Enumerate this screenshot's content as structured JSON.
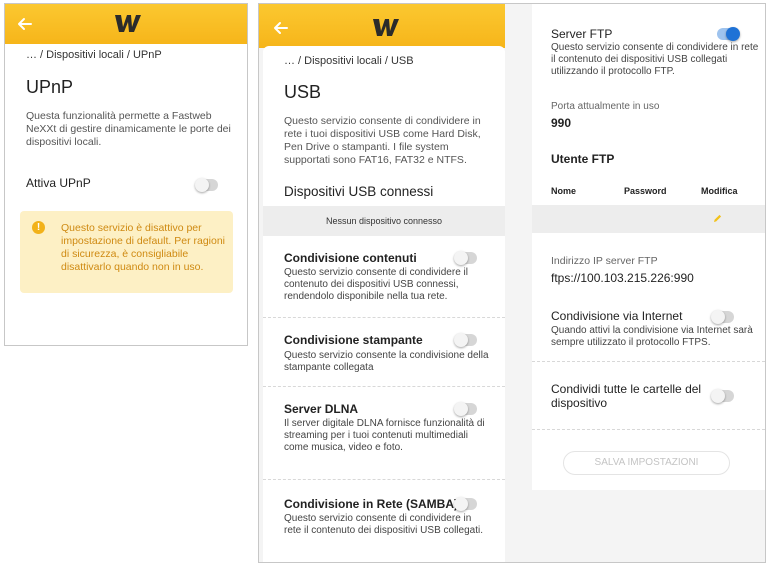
{
  "panel1": {
    "breadcrumb": "… / Dispositivi locali / UPnP",
    "title": "UPnP",
    "description": "Questa funzionalità permette a Fastweb NeXXt di gestire dinamicamente le porte dei dispositivi locali.",
    "toggle_label": "Attiva UPnP",
    "toggle_on": false,
    "warning": "Questo servizio è disattivo per impostazione di default. Per ragioni di sicurezza, è consigliabile disattivarlo quando non in uso."
  },
  "panel2": {
    "breadcrumb": "… / Dispositivi locali / USB",
    "title": "USB",
    "description": "Questo servizio consente di condividere in rete i tuoi dispositivi USB come Hard Disk, Pen Drive o stampanti. I file system supportati sono FAT16, FAT32 e NTFS.",
    "connected_heading": "Dispositivi USB connessi",
    "no_device": "Nessun dispositivo connesso",
    "sections": [
      {
        "title": "Condivisione contenuti",
        "desc": "Questo servizio consente di condividere il contenuto dei dispositivi USB connessi, rendendolo disponibile nella tua rete.",
        "on": false
      },
      {
        "title": "Condivisione stampante",
        "desc": "Questo servizio consente la condivisione della stampante collegata",
        "on": false
      },
      {
        "title": "Server DLNA",
        "desc": "Il server digitale DLNA fornisce funzionalità di streaming per i tuoi contenuti multimediali come musica, video e foto.",
        "on": false
      },
      {
        "title": "Condivisione in Rete (SAMBA)",
        "desc": "Questo servizio consente di condividere in rete il contenuto dei dispositivi USB collegati.",
        "on": false
      }
    ]
  },
  "panel3": {
    "ftp_title": "Server FTP",
    "ftp_desc": "Questo servizio consente di condividere in rete il contenuto dei dispositivi USB collegati utilizzando il protocollo FTP.",
    "ftp_on": true,
    "port_label": "Porta attualmente in uso",
    "port_value": "990",
    "user_heading": "Utente FTP",
    "col_name": "Nome",
    "col_password": "Password",
    "col_edit": "Modifica",
    "ip_label": "Indirizzo IP server FTP",
    "ip_value": "ftps://100.103.215.226:990",
    "internet_title": "Condivisione via Internet",
    "internet_desc": "Quando attivi la condivisione via Internet sarà sempre utilizzato il protocollo FTPS.",
    "internet_on": false,
    "share_all_title": "Condividi tutte le cartelle del dispositivo",
    "share_all_on": false,
    "save_button": "SALVA IMPOSTAZIONI"
  },
  "colors": {
    "brand_yellow": "#f6b51a",
    "toggle_on": "#1f72d6",
    "warning_bg": "#fdf0c5",
    "warning_text": "#cf8a12"
  },
  "icons": {
    "back": "arrow-left-icon",
    "logo": "fastweb-logo-icon",
    "info": "info-icon",
    "edit": "pencil-icon"
  }
}
